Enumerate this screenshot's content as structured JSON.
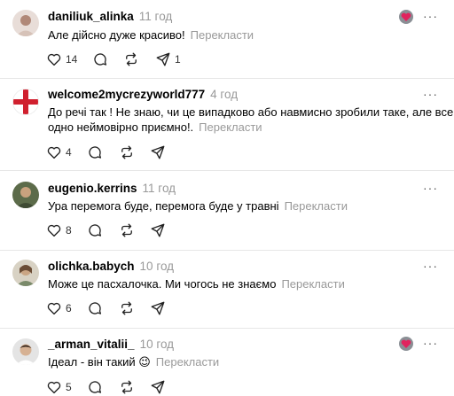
{
  "comments": [
    {
      "username": "daniliuk_alinka",
      "time": "11 год",
      "lines": [
        "Але дійсно дуже красиво!"
      ],
      "translate": "Перекласти",
      "likes": "14",
      "shares": "1"
    },
    {
      "username": "welcome2mycrezyworld777",
      "time": "4 год",
      "lines": [
        "До речі так ! Не знаю, чи це випадково або навмисно зробили таке, але все",
        "одно неймовірно приємно!."
      ],
      "translate": "Перекласти",
      "likes": "4",
      "shares": ""
    },
    {
      "username": "eugenio.kerrins",
      "time": "11 год",
      "lines": [
        "Ура перемога буде, перемога буде у травні"
      ],
      "translate": "Перекласти",
      "likes": "8",
      "shares": ""
    },
    {
      "username": "olichka.babych",
      "time": "10 год",
      "lines": [
        "Може це пасхалочка. Ми чогось не знаємо"
      ],
      "translate": "Перекласти",
      "likes": "6",
      "shares": ""
    },
    {
      "username": "_arman_vitalii_",
      "time": "10 год",
      "lines": [
        "Ідеал - він такий 😉"
      ],
      "translate": "Перекласти",
      "likes": "5",
      "shares": ""
    }
  ],
  "more_label": "···"
}
